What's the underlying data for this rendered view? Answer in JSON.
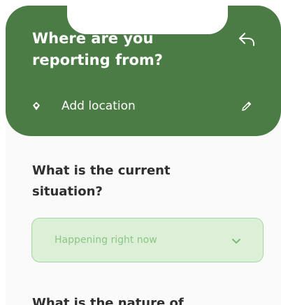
{
  "header": {
    "title": "Where are you reporting from?",
    "add_location_label": "Add location",
    "background_color": "#4b7c46",
    "icons": {
      "back": "undo-arrow-icon",
      "location": "location-pin-icon",
      "edit": "pencil-icon"
    }
  },
  "situation": {
    "question": "What is the current situation?",
    "selected": "Happening right now",
    "dropdown_icon": "chevron-down-icon",
    "field_color": "#dcf0d8"
  },
  "nature": {
    "question": "What is the nature of"
  }
}
